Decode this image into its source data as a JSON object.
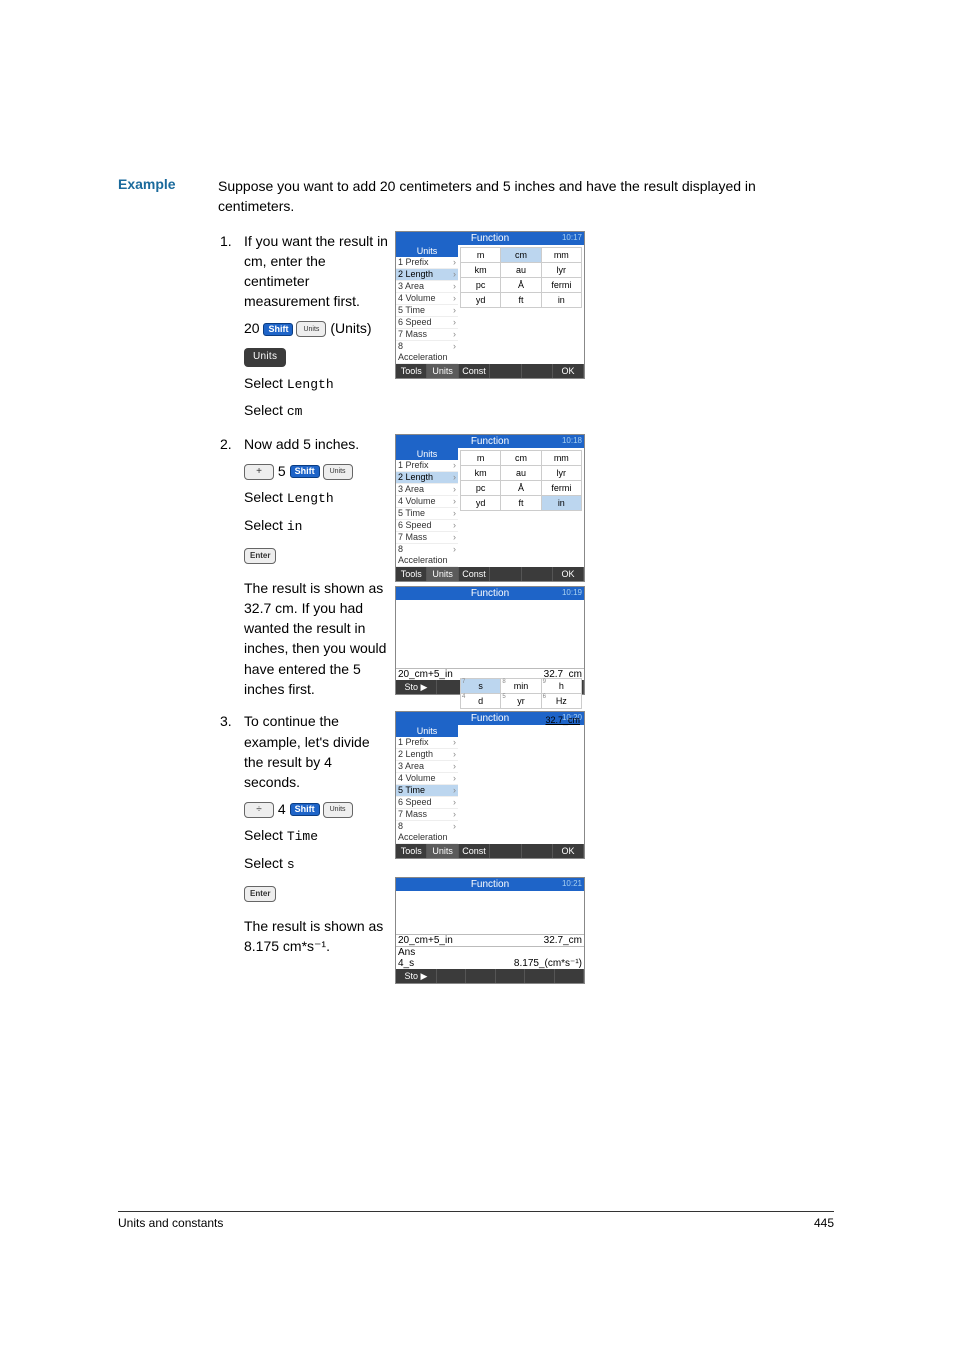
{
  "heading": "Example",
  "intro": "Suppose you want to add 20 centimeters and 5 inches and have the result displayed in centimeters.",
  "footer": {
    "left": "Units and constants",
    "right": "445"
  },
  "labels": {
    "units_paren": "(Units)",
    "units_soft": "Units",
    "shift": "Shift",
    "enter": "Enter",
    "key_units_sub": "Units"
  },
  "steps": [
    {
      "num": "1.",
      "text_parts": {
        "a": "If you want the result in cm, enter the centimeter measurement first.",
        "b": "20",
        "c": "Select ",
        "d": "Length",
        "e": "Select ",
        "f": "cm"
      }
    },
    {
      "num": "2.",
      "text_parts": {
        "a": "Now add 5 inches.",
        "b": " 5 ",
        "c": "Select ",
        "d": "Length",
        "e": "Select ",
        "f": "in",
        "g": "The result is shown as 32.7 cm. If you had wanted the result in inches, then you would have entered the 5 inches first."
      }
    },
    {
      "num": "3.",
      "text_parts": {
        "a": "To continue the example, let's divide the result by 4 seconds.",
        "b": " 4 ",
        "c": "Select ",
        "d": "Time",
        "e": "Select ",
        "f": "s",
        "g": "The result is shown as 8.175 cm*s⁻¹."
      }
    }
  ],
  "calc_header": "Function",
  "menu": {
    "title": "Units",
    "items": [
      "1 Prefix",
      "2 Length",
      "3 Area",
      "4 Volume",
      "5 Time",
      "6 Speed",
      "7 Mass",
      "8 Acceleration"
    ]
  },
  "length_grid": [
    [
      "m",
      "cm",
      "mm"
    ],
    [
      "km",
      "au",
      "lyr"
    ],
    [
      "pc",
      "Å",
      "fermi"
    ],
    [
      "yd",
      "ft",
      "in"
    ]
  ],
  "time_grid": [
    [
      "s",
      "min",
      "h"
    ],
    [
      "d",
      "yr",
      "Hz"
    ]
  ],
  "time_sup": [
    "7",
    "8",
    "9",
    "4",
    "5",
    "6"
  ],
  "results": {
    "line1_left": "20_cm+5_in",
    "line1_right": "32.7_cm",
    "ans": "Ans",
    "line2_left": "4_s",
    "line2_right": "8.175_(cm*s⁻¹)"
  },
  "times": [
    "10:17",
    "10:18",
    "10:19",
    "10:20",
    "10:21"
  ],
  "footer_tabs": {
    "tools": "Tools",
    "units": "Units",
    "const": "Const",
    "ok": "OK",
    "sto": "Sto ▶"
  }
}
